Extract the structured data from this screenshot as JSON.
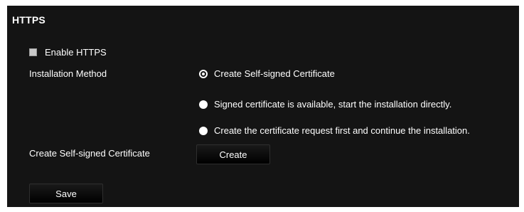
{
  "section": {
    "title": "HTTPS"
  },
  "enable_https": {
    "label": "Enable HTTPS",
    "checked": false
  },
  "installation_method": {
    "label": "Installation Method",
    "options": [
      {
        "label": "Create Self-signed Certificate",
        "selected": true
      },
      {
        "label": "Signed certificate is available, start the installation directly.",
        "selected": false
      },
      {
        "label": "Create the certificate request first and continue the installation.",
        "selected": false
      }
    ]
  },
  "self_signed": {
    "label": "Create Self-signed Certificate",
    "button_label": "Create"
  },
  "actions": {
    "save_label": "Save"
  }
}
